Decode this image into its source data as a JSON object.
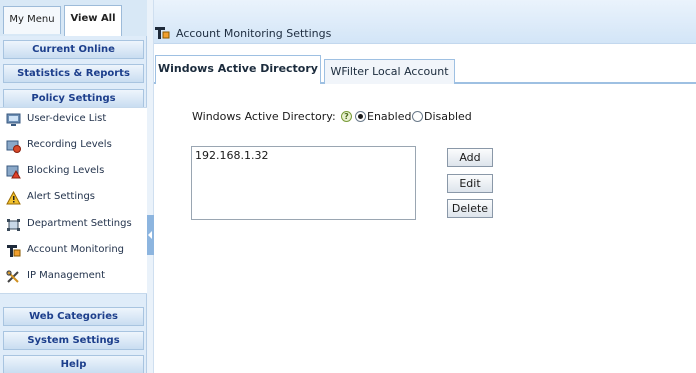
{
  "sidebar": {
    "tabs": [
      {
        "label": "My Menu"
      },
      {
        "label": "View All"
      }
    ],
    "sections": {
      "current_online": "Current Online",
      "statistics_reports": "Statistics & Reports",
      "policy_settings": "Policy Settings",
      "web_categories": "Web Categories",
      "system_settings": "System Settings",
      "help": "Help"
    },
    "items": [
      {
        "label": "User-device List",
        "icon": "user-device-list-icon"
      },
      {
        "label": "Recording Levels",
        "icon": "recording-levels-icon"
      },
      {
        "label": "Blocking Levels",
        "icon": "blocking-levels-icon"
      },
      {
        "label": "Alert Settings",
        "icon": "alert-settings-icon"
      },
      {
        "label": "Department Settings",
        "icon": "department-settings-icon"
      },
      {
        "label": "Account Monitoring",
        "icon": "account-monitoring-icon"
      },
      {
        "label": "IP Management",
        "icon": "ip-management-icon"
      }
    ]
  },
  "main": {
    "title": "Account Monitoring Settings",
    "tabs": [
      {
        "label": "Windows Active Directory"
      },
      {
        "label": "WFilter Local Account"
      }
    ],
    "ad_setting": {
      "label": "Windows Active Directory:",
      "help_glyph": "?",
      "options": [
        {
          "label": "Enabled",
          "selected": true
        },
        {
          "label": "Disabled",
          "selected": false
        }
      ]
    },
    "servers": [
      "192.168.1.32"
    ],
    "buttons": {
      "add": "Add",
      "edit": "Edit",
      "delete": "Delete"
    }
  },
  "colors": {
    "sidebar_bg": "#dfecf9",
    "section_text": "#1d3f8c",
    "tab_border": "#9ec0e2",
    "accent": "#8db5df"
  }
}
